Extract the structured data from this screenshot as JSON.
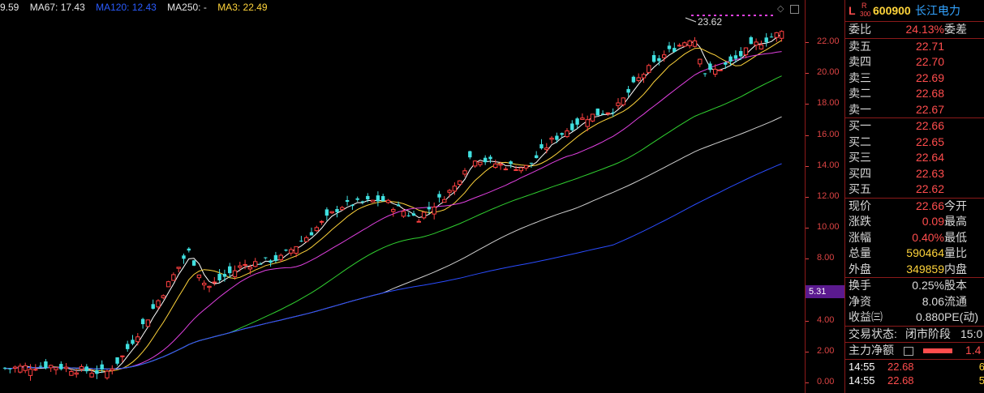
{
  "header": {
    "ma_first": "9.59",
    "ma67": "MA67: 17.43",
    "ma120": "MA120: 12.43",
    "ma250": "MA250: -",
    "ma3": "MA3: 22.49",
    "colors": {
      "ma_first": "#e6e6e6",
      "ma67": "#e6e6e6",
      "ma120": "#2a5cff",
      "ma250": "#e6e6e6",
      "ma3": "#ffd43b"
    }
  },
  "chart_annotation": "23.62",
  "chart_data": {
    "type": "candlestick",
    "ylim": [
      0,
      24
    ],
    "y_ticks": [
      "22.00",
      "20.00",
      "18.00",
      "16.00",
      "14.00",
      "12.00",
      "10.00",
      "8.00",
      "6.00",
      "4.00",
      "2.00",
      "0.00"
    ],
    "current_price_marker": "5.31",
    "high_annotation": 23.62
  },
  "quote": {
    "flag_l": "L",
    "flag_r": "R",
    "flag_300": "300",
    "code": "600900",
    "name": "长江电力",
    "weibi_label": "委比",
    "weibi_value": "24.13%",
    "weicha_label": "委差",
    "asks": [
      {
        "label": "卖五",
        "price": "22.71"
      },
      {
        "label": "卖四",
        "price": "22.70"
      },
      {
        "label": "卖三",
        "price": "22.69"
      },
      {
        "label": "卖二",
        "price": "22.68"
      },
      {
        "label": "卖一",
        "price": "22.67"
      }
    ],
    "bids": [
      {
        "label": "买一",
        "price": "22.66"
      },
      {
        "label": "买二",
        "price": "22.65"
      },
      {
        "label": "买三",
        "price": "22.64"
      },
      {
        "label": "买四",
        "price": "22.63"
      },
      {
        "label": "买五",
        "price": "22.62"
      }
    ],
    "stats": [
      {
        "label": "现价",
        "value": "22.66",
        "label2": "今开"
      },
      {
        "label": "涨跌",
        "value": "0.09",
        "label2": "最高"
      },
      {
        "label": "涨幅",
        "value": "0.40%",
        "label2": "最低"
      },
      {
        "label": "总量",
        "value": "590464",
        "label2": "量比"
      },
      {
        "label": "外盘",
        "value": "349859",
        "label2": "内盘"
      }
    ],
    "stats2": [
      {
        "label": "换手",
        "value": "0.25%",
        "label2": "股本"
      },
      {
        "label": "净资",
        "value": "8.06",
        "label2": "流通"
      },
      {
        "label": "收益㈢",
        "value": "0.880",
        "label2": "PE(动)"
      }
    ],
    "status_label": "交易状态:",
    "status_value": "闭市阶段",
    "status_time": "15:0",
    "main_flow_label": "主力净额",
    "main_flow_value": "1.4",
    "trades": [
      {
        "time": "14:55",
        "price": "22.68",
        "vol": "6"
      },
      {
        "time": "14:55",
        "price": "22.68",
        "vol": "5"
      }
    ]
  }
}
